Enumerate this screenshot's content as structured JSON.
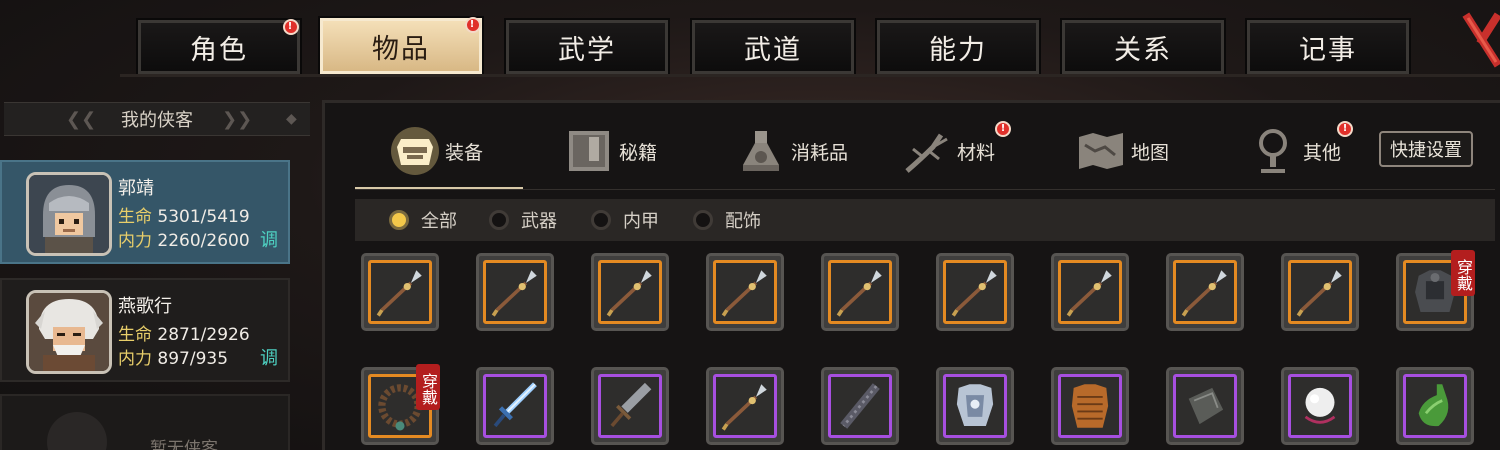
{
  "top_tabs": [
    {
      "label": "角色",
      "notif": true,
      "active": false
    },
    {
      "label": "物品",
      "notif": true,
      "active": true
    },
    {
      "label": "武学",
      "notif": false,
      "active": false
    },
    {
      "label": "武道",
      "notif": false,
      "active": false
    },
    {
      "label": "能力",
      "notif": false,
      "active": false
    },
    {
      "label": "关系",
      "notif": false,
      "active": false
    },
    {
      "label": "记事",
      "notif": false,
      "active": false
    }
  ],
  "notif_mark": "!",
  "left_panel": {
    "header": "我的侠客",
    "heroes": [
      {
        "name": "郭靖",
        "hp_label": "生命",
        "hp": "5301/5419",
        "mp_label": "内力",
        "mp": "2260/2600",
        "tune": "调",
        "selected": true
      },
      {
        "name": "燕歌行",
        "hp_label": "生命",
        "hp": "2871/2926",
        "mp_label": "内力",
        "mp": "897/935",
        "tune": "调",
        "selected": false
      }
    ],
    "empty_slot_text": "暂无侠客"
  },
  "categories": [
    {
      "label": "装备",
      "icon": "armor-icon",
      "notif": false,
      "active": true
    },
    {
      "label": "秘籍",
      "icon": "book-icon",
      "notif": false,
      "active": false
    },
    {
      "label": "消耗品",
      "icon": "potion-icon",
      "notif": false,
      "active": false
    },
    {
      "label": "材料",
      "icon": "herb-icon",
      "notif": true,
      "active": false
    },
    {
      "label": "地图",
      "icon": "map-icon",
      "notif": false,
      "active": false
    },
    {
      "label": "其他",
      "icon": "misc-icon",
      "notif": true,
      "active": false
    }
  ],
  "shortcut_button": "快捷设置",
  "filters": [
    {
      "label": "全部",
      "selected": true
    },
    {
      "label": "武器",
      "selected": false
    },
    {
      "label": "内甲",
      "selected": false
    },
    {
      "label": "配饰",
      "selected": false
    }
  ],
  "equip_badge": "穿戴",
  "items_row1": [
    {
      "icon": "spear-icon",
      "rarity": "orange",
      "equipped": false
    },
    {
      "icon": "spear-icon",
      "rarity": "orange",
      "equipped": false
    },
    {
      "icon": "spear-icon",
      "rarity": "orange",
      "equipped": false
    },
    {
      "icon": "spear-icon",
      "rarity": "orange",
      "equipped": false
    },
    {
      "icon": "spear-icon",
      "rarity": "orange",
      "equipped": false
    },
    {
      "icon": "spear-icon",
      "rarity": "orange",
      "equipped": false
    },
    {
      "icon": "spear-icon",
      "rarity": "orange",
      "equipped": false
    },
    {
      "icon": "spear-icon",
      "rarity": "orange",
      "equipped": false
    },
    {
      "icon": "spear-icon",
      "rarity": "orange",
      "equipped": false
    },
    {
      "icon": "armor-vest-icon",
      "rarity": "orange",
      "equipped": true
    }
  ],
  "items_row2": [
    {
      "icon": "prayer-beads-icon",
      "rarity": "orange",
      "equipped": true
    },
    {
      "icon": "blue-sword-icon",
      "rarity": "purple",
      "equipped": false
    },
    {
      "icon": "broadsword-icon",
      "rarity": "purple",
      "equipped": false
    },
    {
      "icon": "spear-icon",
      "rarity": "purple",
      "equipped": false
    },
    {
      "icon": "staff-icon",
      "rarity": "purple",
      "equipped": false
    },
    {
      "icon": "silver-armor-icon",
      "rarity": "purple",
      "equipped": false
    },
    {
      "icon": "scale-armor-icon",
      "rarity": "purple",
      "equipped": false
    },
    {
      "icon": "stone-icon",
      "rarity": "purple",
      "equipped": false
    },
    {
      "icon": "pearl-ornament-icon",
      "rarity": "purple",
      "equipped": false
    },
    {
      "icon": "jade-pendant-icon",
      "rarity": "purple",
      "equipped": false
    }
  ],
  "colors": {
    "orange_rarity": "#e48a22",
    "purple_rarity": "#a74fe0",
    "active_tab": "#f4dfb8",
    "selected_hero": "#355668",
    "stat_label": "#e8ce6a",
    "tune": "#4ed1c2",
    "notif": "#e0302a",
    "equip_badge": "#b31e1e"
  }
}
